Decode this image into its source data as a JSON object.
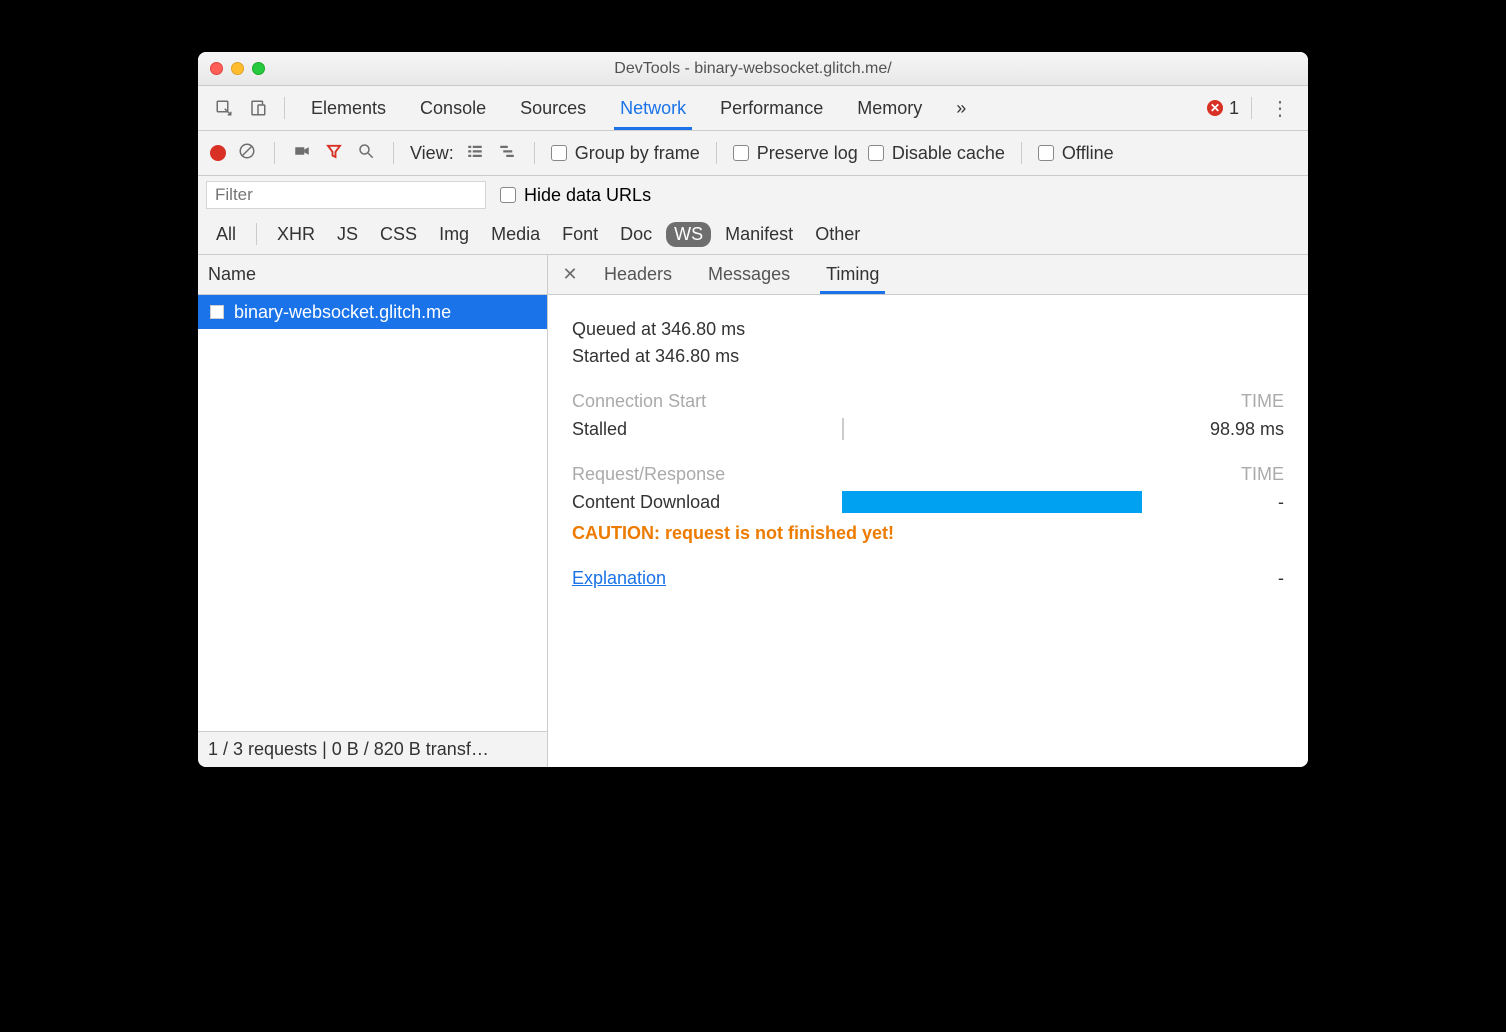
{
  "window": {
    "title": "DevTools - binary-websocket.glitch.me/"
  },
  "tabs": {
    "items": [
      "Elements",
      "Console",
      "Sources",
      "Network",
      "Performance",
      "Memory"
    ],
    "active": "Network",
    "overflow": "»",
    "error_count": "1"
  },
  "toolbar": {
    "view_label": "View:",
    "group_by_frame": "Group by frame",
    "preserve_log": "Preserve log",
    "disable_cache": "Disable cache",
    "offline": "Offline"
  },
  "filter": {
    "placeholder": "Filter",
    "hide_data_urls": "Hide data URLs",
    "types": [
      "All",
      "XHR",
      "JS",
      "CSS",
      "Img",
      "Media",
      "Font",
      "Doc",
      "WS",
      "Manifest",
      "Other"
    ],
    "active_type": "WS"
  },
  "left": {
    "header": "Name",
    "request_name": "binary-websocket.glitch.me",
    "status": "1 / 3 requests | 0 B / 820 B transf…"
  },
  "subtabs": {
    "items": [
      "Headers",
      "Messages",
      "Timing"
    ],
    "active": "Timing"
  },
  "timing": {
    "queued": "Queued at 346.80 ms",
    "started": "Started at 346.80 ms",
    "section_connection": "Connection Start",
    "time_header": "TIME",
    "stalled_label": "Stalled",
    "stalled_value": "98.98 ms",
    "section_request": "Request/Response",
    "content_download_label": "Content Download",
    "content_download_value": "-",
    "caution": "CAUTION: request is not finished yet!",
    "explanation": "Explanation",
    "explanation_value": "-"
  }
}
